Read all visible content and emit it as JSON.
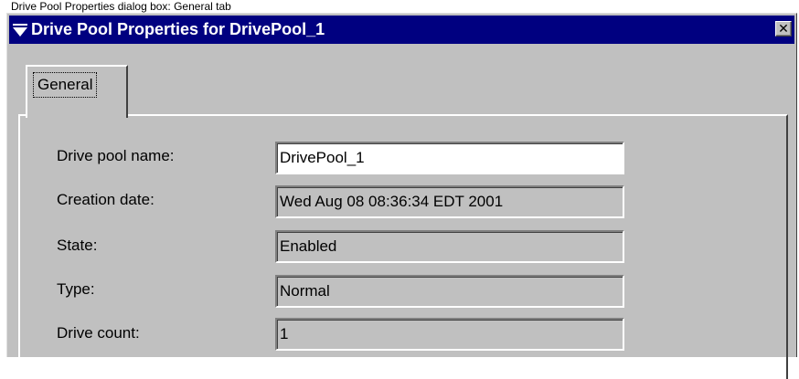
{
  "caption": "Drive Pool Properties dialog box: General tab",
  "window": {
    "title": "Drive Pool Properties for DrivePool_1",
    "title_icon": "down-triangle-menu-icon",
    "close_icon": "close-icon",
    "close_glyph": "✕"
  },
  "tabs": [
    {
      "label": "General",
      "selected": true
    }
  ],
  "fields": {
    "drive_pool_name": {
      "label": "Drive pool name:",
      "value": "DrivePool_1"
    },
    "creation_date": {
      "label": "Creation date:",
      "value": "Wed Aug 08 08:36:34 EDT 2001"
    },
    "state": {
      "label": "State:",
      "value": "Enabled"
    },
    "type": {
      "label": "Type:",
      "value": "Normal"
    },
    "drive_count": {
      "label": "Drive count:",
      "value": "1"
    }
  },
  "colors": {
    "titlebar": "#000080",
    "dialog_face": "#c0c0c0"
  }
}
